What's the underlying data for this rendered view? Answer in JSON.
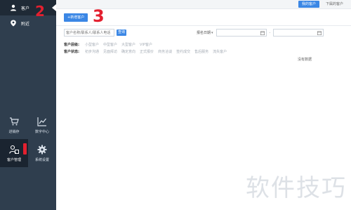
{
  "sidebar": {
    "nav": [
      {
        "label": "客户"
      },
      {
        "label": "附近"
      }
    ],
    "grid": [
      {
        "label": "进销存"
      },
      {
        "label": "数字中心"
      },
      {
        "label": "客户管理"
      },
      {
        "label": "系统设置"
      }
    ]
  },
  "annotations": {
    "mark1": "1",
    "mark2": "2",
    "mark3": "3"
  },
  "topbar": {
    "tabs": [
      {
        "label": "我的客户",
        "active": true
      },
      {
        "label": "下属的客户",
        "active": false
      }
    ]
  },
  "main": {
    "new_button": "+新增客户",
    "search": {
      "placeholder": "客户名称/联系人/联系人电话",
      "button": "查询"
    },
    "date": {
      "label": "报名日期",
      "separator": "-"
    },
    "filters": [
      {
        "label": "客户层级:",
        "options": [
          "小型客户",
          "中型客户",
          "大型客户",
          "VIP客户"
        ]
      },
      {
        "label": "客户状态:",
        "options": [
          "初步沟通",
          "见面拜访",
          "确定意向",
          "正式报价",
          "商务洽谈",
          "签约成交",
          "售后服务",
          "流失客户"
        ]
      }
    ],
    "empty_text": "没有数据"
  },
  "watermark": "软件技巧",
  "colors": {
    "sidebar_bg": "#2f3e4e",
    "accent": "#3b87e5",
    "annotation": "#e3202f"
  }
}
